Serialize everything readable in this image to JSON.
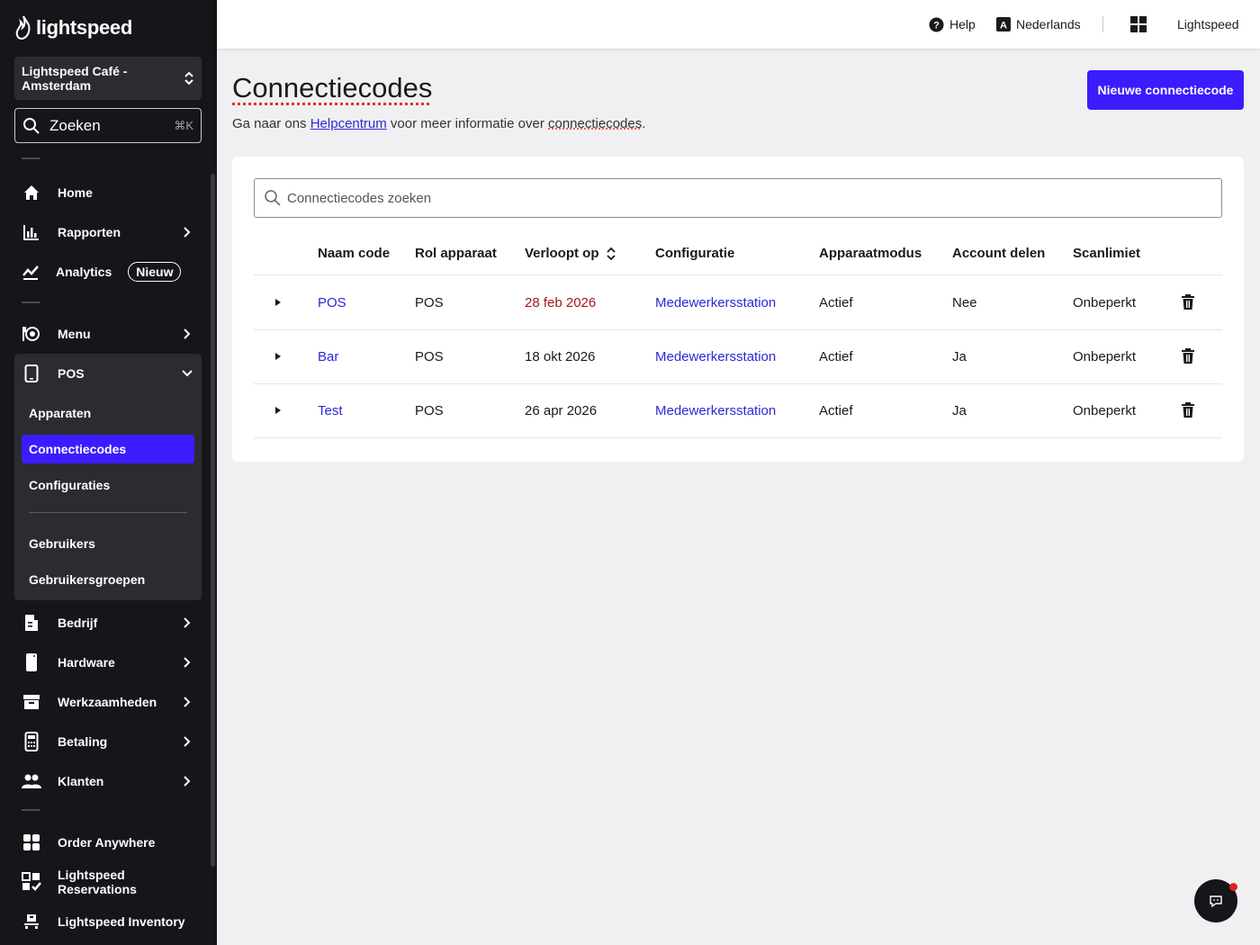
{
  "brand": {
    "logo_text": "lightspeed"
  },
  "sidebar": {
    "store_name": "Lightspeed Café - Amsterdam",
    "search_label": "Zoeken",
    "search_shortcut": "⌘K",
    "items": {
      "home": "Home",
      "rapporten": "Rapporten",
      "analytics": "Analytics",
      "analytics_badge": "Nieuw",
      "menu": "Menu",
      "pos": "POS",
      "bedrijf": "Bedrijf",
      "hardware": "Hardware",
      "werkzaamheden": "Werkzaamheden",
      "betaling": "Betaling",
      "klanten": "Klanten",
      "order_anywhere": "Order Anywhere",
      "reservations": "Lightspeed Reservations",
      "inventory": "Lightspeed Inventory"
    },
    "pos_sub": {
      "apparaten": "Apparaten",
      "connectiecodes": "Connectiecodes",
      "configuraties": "Configuraties",
      "gebruikers": "Gebruikers",
      "gebruikersgroepen": "Gebruikersgroepen"
    }
  },
  "topbar": {
    "help": "Help",
    "language": "Nederlands",
    "account": "Lightspeed"
  },
  "page": {
    "title": "Connectiecodes",
    "subtitle_prefix": "Ga naar ons ",
    "subtitle_link": "Helpcentrum",
    "subtitle_middle": " voor meer informatie over ",
    "subtitle_term": "connectiecodes",
    "subtitle_end": ".",
    "new_button": "Nieuwe connectiecode"
  },
  "table": {
    "search_placeholder": "Connectiecodes zoeken",
    "columns": {
      "name": "Naam code",
      "role": "Rol apparaat",
      "expires": "Verloopt op",
      "config": "Configuratie",
      "mode": "Apparaatmodus",
      "share": "Account delen",
      "scan": "Scanlimiet"
    },
    "rows": [
      {
        "name": "POS",
        "role": "POS",
        "expires": "28 feb 2026",
        "config": "Medewerkersstation",
        "mode": "Actief",
        "share": "Nee",
        "scan": "Onbeperkt"
      },
      {
        "name": "Bar",
        "role": "POS",
        "expires": "18 okt 2026",
        "config": "Medewerkersstation",
        "mode": "Actief",
        "share": "Ja",
        "scan": "Onbeperkt"
      },
      {
        "name": "Test",
        "role": "POS",
        "expires": "26 apr 2026",
        "config": "Medewerkersstation",
        "mode": "Actief",
        "share": "Ja",
        "scan": "Onbeperkt"
      }
    ]
  },
  "colors": {
    "accent": "#3b1cff",
    "link": "#2a2ad6",
    "expired": "#a11818",
    "sidebar_bg": "#16161a"
  }
}
